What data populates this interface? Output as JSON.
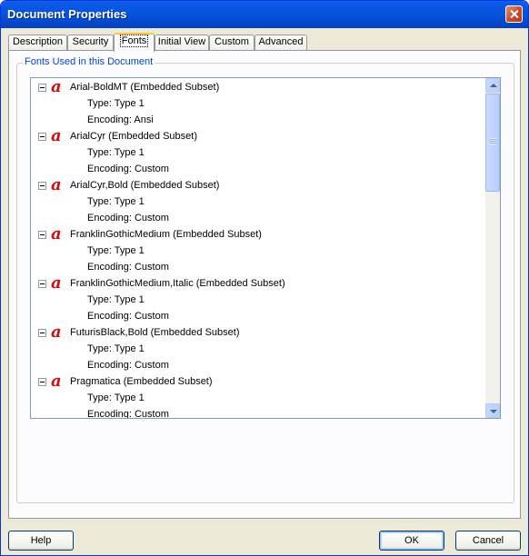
{
  "window": {
    "title": "Document Properties"
  },
  "tabs": [
    {
      "label": "Description",
      "active": false
    },
    {
      "label": "Security",
      "active": false
    },
    {
      "label": "Fonts",
      "active": true
    },
    {
      "label": "Initial View",
      "active": false
    },
    {
      "label": "Custom",
      "active": false
    },
    {
      "label": "Advanced",
      "active": false
    }
  ],
  "fonts_group": {
    "label": "Fonts Used in this Document",
    "icon": "font-icon",
    "icon_glyph": "a",
    "fonts": [
      {
        "name": "Arial-BoldMT (Embedded Subset)",
        "type": "Type: Type 1",
        "encoding": "Encoding: Ansi"
      },
      {
        "name": "ArialCyr (Embedded Subset)",
        "type": "Type: Type 1",
        "encoding": "Encoding: Custom"
      },
      {
        "name": "ArialCyr,Bold (Embedded Subset)",
        "type": "Type: Type 1",
        "encoding": "Encoding: Custom"
      },
      {
        "name": "FranklinGothicMedium (Embedded Subset)",
        "type": "Type: Type 1",
        "encoding": "Encoding: Custom"
      },
      {
        "name": "FranklinGothicMedium,Italic (Embedded Subset)",
        "type": "Type: Type 1",
        "encoding": "Encoding: Custom"
      },
      {
        "name": "FuturisBlack,Bold (Embedded Subset)",
        "type": "Type: Type 1",
        "encoding": "Encoding: Custom"
      },
      {
        "name": "Pragmatica (Embedded Subset)",
        "type": "Type: Type 1",
        "encoding": "Encoding: Custom"
      }
    ]
  },
  "buttons": {
    "help": "Help",
    "ok": "OK",
    "cancel": "Cancel"
  },
  "colors": {
    "titlebar": "#0453dd",
    "group_label": "#0046d5",
    "font_icon": "#d01010",
    "active_tab_highlight": "#ffc73c"
  }
}
